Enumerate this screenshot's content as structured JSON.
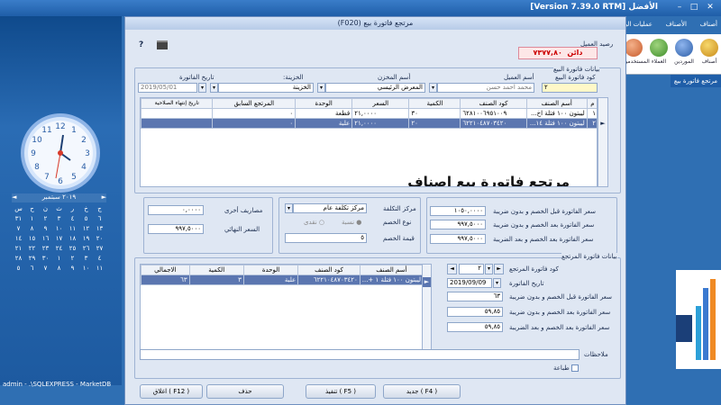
{
  "app": {
    "title": "الأفضل [Version 7.39.0  RTM]",
    "minimize": "–",
    "maximize": "□",
    "close": "✕"
  },
  "ribbon": {
    "menu": [
      "أصناف",
      "الأصناف",
      "عمليات البرنامج"
    ],
    "buttons": [
      {
        "label": "المستخدمين"
      },
      {
        "label": "العملاء"
      },
      {
        "label": "الموردين"
      },
      {
        "label": "أصناف"
      }
    ],
    "side_tab": "مرتجع فاتورة بيع"
  },
  "status": {
    "text": "admin - .\\SQLEXPRESS - MarketDB"
  },
  "calendar": {
    "month": "سبتمبر",
    "year": "٢٠١٩",
    "prev": "◄",
    "next": "►",
    "weekdays": [
      "س",
      "ح",
      "ن",
      "ث",
      "ر",
      "خ",
      "ج"
    ],
    "rows": [
      [
        "٣١",
        "١",
        "٢",
        "٣",
        "٤",
        "٥",
        "٦"
      ],
      [
        "٧",
        "٨",
        "٩",
        "١٠",
        "١١",
        "١٢",
        "١٣"
      ],
      [
        "١٤",
        "١٥",
        "١٦",
        "١٧",
        "١٨",
        "١٩",
        "٢٠"
      ],
      [
        "٢١",
        "٢٢",
        "٢٣",
        "٢٤",
        "٢٥",
        "٢٦",
        "٢٧"
      ],
      [
        "٢٨",
        "٢٩",
        "٣٠",
        "١",
        "٢",
        "٣",
        "٤"
      ],
      [
        "٥",
        "٦",
        "٧",
        "٨",
        "٩",
        "١٠",
        "١١"
      ]
    ]
  },
  "dialog": {
    "title": "مرتجع فاتورة بيع (F020)",
    "help": "?",
    "customer_balance_label": "رصيد العميل",
    "customer_balance": "٧٣٧٧,٨٠",
    "customer_balance_suffix": "دائن",
    "invoice_section": "بيانات فاتورة البيع",
    "invoice_code_label": "كود فاتورة البيع",
    "invoice_code": "٢",
    "customer_name_label": "أسم العميل",
    "customer_name": "محمد احمد حسن",
    "store_label": "أسم المخزن",
    "store": "المعرض الرئيسي",
    "safe_label": "الخزينة:",
    "safe": "الخزينة",
    "invoice_date_label": "تاريخ الفاتورة",
    "invoice_date": "2019/05/01",
    "grid_headers": [
      "م",
      "أسم الصنف",
      "كود الصنف",
      "الكمية",
      "السعر",
      "الوحدة",
      "المرتجع السابق",
      "تاريخ إنتهاء الصلاحية"
    ],
    "grid_rows": [
      [
        "١",
        "ليبتون ١٠٠ فتلة اخ...",
        "٦٢٨١٠٠٦٩٥١٠٠٩",
        "٣٠",
        "٢١,٠٠٠٠",
        "قطعة",
        "٠",
        ""
      ],
      [
        "٢",
        "ليبتون ١٠٠ فتلة ١٤...",
        "٦٢٢١٠٤٨٧٠٣٤٢٠",
        "٢٠",
        "٢١,٠٠٠٠",
        "علبة",
        "٠",
        ""
      ]
    ],
    "watermark": "مرتجع فاتورة بيع اصناف",
    "before_discount_label": "سعر الفاتورة قبل الخصم و بدون ضريبة",
    "before_discount": "١٠٥٠,٠٠٠٠",
    "after_discount_label": "سعر الفاتورة بعد الخصم و بدون ضريبة",
    "after_discount": "٩٩٧,٥٠٠٠",
    "after_tax_label": "سعر الفاتورة بعد الخصم و بعد الضريبة",
    "after_tax": "٩٩٧,٥٠٠٠",
    "cost_center_label": "مركز التكلفة",
    "cost_center": "مركز تكلفة عام",
    "discount_type_label": "نوع الخصم",
    "discount_percent": "نسبة",
    "discount_cash": "نقدى",
    "discount_value_label": "قيمة الخصم",
    "discount_value": "٥",
    "other_expenses_label": "مصاريف أخرى",
    "other_expenses": "٠,٠٠٠٠",
    "final_price_label": "السعر النهائي",
    "final_price": "٩٩٧,٥٠٠٠",
    "return_section": "بيانات فاتورة المرتجع",
    "return_code_label": "كود فاتورة المرتجع",
    "return_code": "٢",
    "return_date_label": "تاريخ الفاتورة",
    "return_date": "2019/09/09",
    "return_before_label": "سعر الفاتورة قبل الخصم و بدون ضريبة",
    "return_before": "٦٣",
    "return_after_label": "سعر الفاتورة بعد الخصم و بدون ضريبة",
    "return_after": "٥٩,٨٥",
    "return_after_tax_label": "سعر الفاتورة بعد الخصم و بعد الضريبة",
    "return_after_tax": "٥٩,٨٥",
    "return_headers": [
      "أسم الصنف",
      "كود الصنف",
      "الوحدة",
      "الكمية",
      "الاجمالي"
    ],
    "return_rows": [
      [
        "ليبتون ١٠٠ فتلة ١ +...",
        "٦٢٢١٠٤٨٧٠٣٤٢٠",
        "علبة",
        "٣",
        "٦٣"
      ]
    ],
    "notes_label": "ملاحظات",
    "print_label": "طباعة",
    "btn_new": "جديد ( F4 )",
    "btn_save": "تنفيذ ( F5 )",
    "btn_delete": "حذف",
    "btn_close": "اغلاق ( F12 )"
  }
}
